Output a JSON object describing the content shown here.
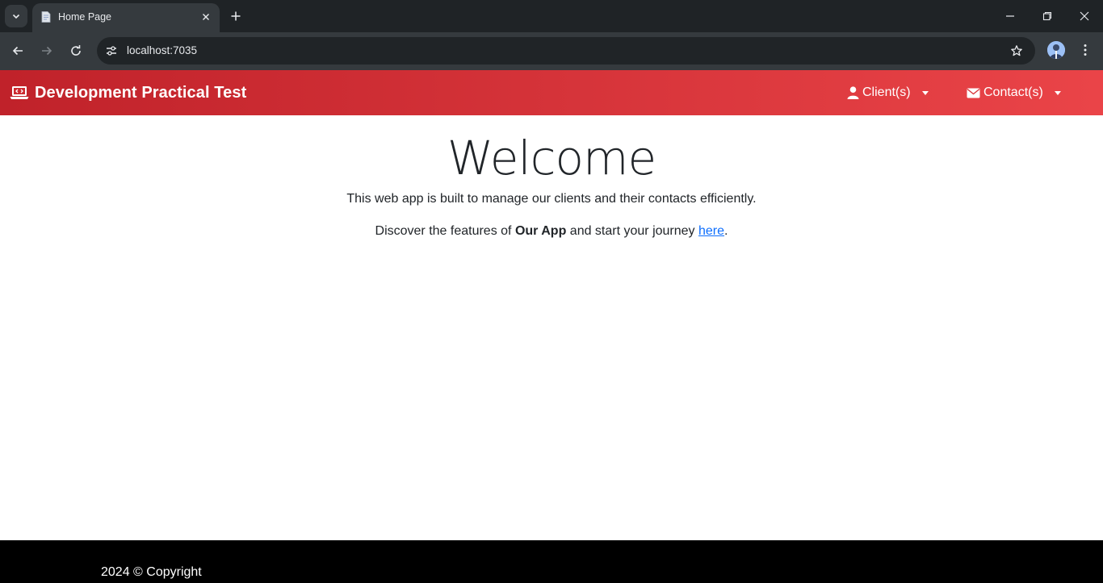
{
  "browser": {
    "tab_title": "Home Page",
    "url": "localhost:7035"
  },
  "navbar": {
    "brand": "Development Practical Test",
    "clients_label": "Client(s)",
    "contacts_label": "Contact(s)",
    "colors": {
      "start": "#c0222a",
      "end": "#ea4448"
    }
  },
  "main": {
    "heading": "Welcome",
    "description": "This web app is built to manage our clients and their contacts efficiently.",
    "discover_prefix": "Discover the features of ",
    "discover_bold": "Our App",
    "discover_middle": " and start your journey ",
    "discover_link": "here",
    "discover_suffix": "."
  },
  "footer": {
    "text": "2024 © Copyright"
  }
}
